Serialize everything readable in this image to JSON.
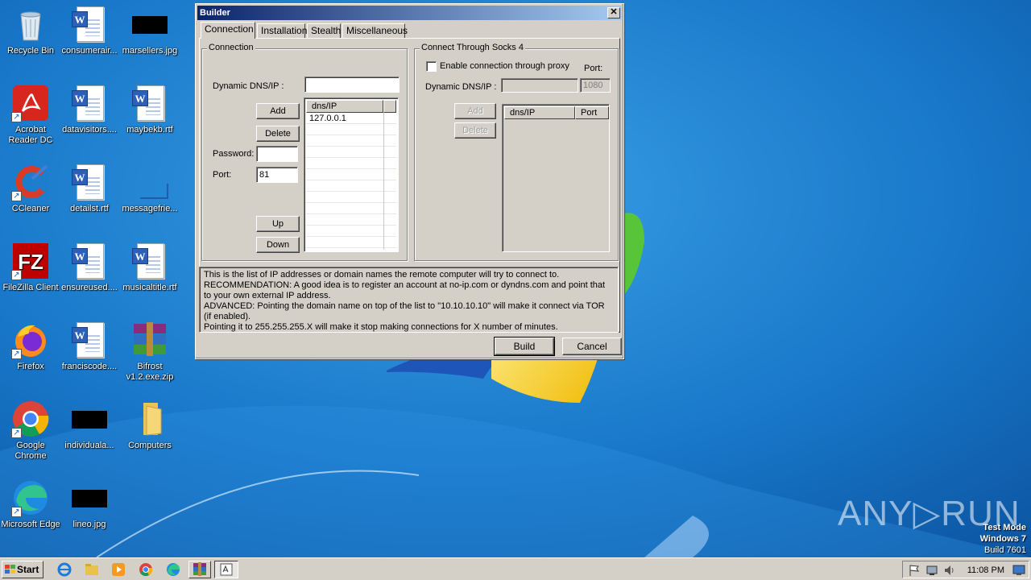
{
  "desktop": {
    "icons": [
      {
        "label": "Recycle Bin"
      },
      {
        "label": "consumerair..."
      },
      {
        "label": "marsellers.jpg"
      },
      {
        "label": "Acrobat Reader DC"
      },
      {
        "label": "datavisitors...."
      },
      {
        "label": "maybekb.rtf"
      },
      {
        "label": "CCleaner"
      },
      {
        "label": "detailst.rtf"
      },
      {
        "label": "messagefrie..."
      },
      {
        "label": "FileZilla Client"
      },
      {
        "label": "ensureused...."
      },
      {
        "label": "musicaltitle.rtf"
      },
      {
        "label": "Firefox"
      },
      {
        "label": "franciscode...."
      },
      {
        "label": "Bifrost v1.2.exe.zip"
      },
      {
        "label": "Google Chrome"
      },
      {
        "label": "individuala..."
      },
      {
        "label": "Computers"
      },
      {
        "label": "Microsoft Edge"
      },
      {
        "label": "lineo.jpg"
      }
    ]
  },
  "builder": {
    "title": "Builder",
    "close_label": "✕",
    "tabs": [
      "Connection",
      "Installation",
      "Stealth",
      "Miscellaneous"
    ],
    "connection": {
      "group_title": "Connection",
      "dns_label": "Dynamic DNS/IP :",
      "dns_value": "",
      "add_label": "Add",
      "delete_label": "Delete",
      "password_label": "Password:",
      "password_value": "",
      "port_label": "Port:",
      "port_value": "81",
      "up_label": "Up",
      "down_label": "Down",
      "list_header": "dns/IP",
      "list_items": [
        "127.0.0.1"
      ]
    },
    "socks": {
      "group_title": "Connect Through Socks 4",
      "enable_label": "Enable connection through proxy",
      "enable_checked": false,
      "port_label": "Port:",
      "dns_label": "Dynamic DNS/IP :",
      "dns_value": "",
      "port_value": "1080",
      "add_label": "Add",
      "delete_label": "Delete",
      "list_header_dns": "dns/IP",
      "list_header_port": "Port"
    },
    "info_lines": [
      "This is the list of IP addresses or domain names the remote computer will try to connect to.",
      "RECOMMENDATION: A good idea is to register an account at no-ip.com or dyndns.com and point that to your own external IP address.",
      "ADVANCED: Pointing the domain name on top of the list to \"10.10.10.10\" will make it connect via TOR (if enabled).",
      "Pointing it to 255.255.255.X will make it stop making connections for X number of minutes."
    ],
    "build_label": "Build",
    "cancel_label": "Cancel"
  },
  "taskbar": {
    "start_label": "Start",
    "clock": "11:08 PM"
  },
  "watermark": {
    "brand": "ANY▷RUN",
    "test_mode": "Test Mode",
    "os": "Windows 7",
    "build": "Build 7601"
  },
  "colors": {
    "dialog_face": "#d4d0c8",
    "titlebar_start": "#0a246a",
    "titlebar_end": "#a6caf0",
    "desktop_blue": "#1a74c4"
  }
}
